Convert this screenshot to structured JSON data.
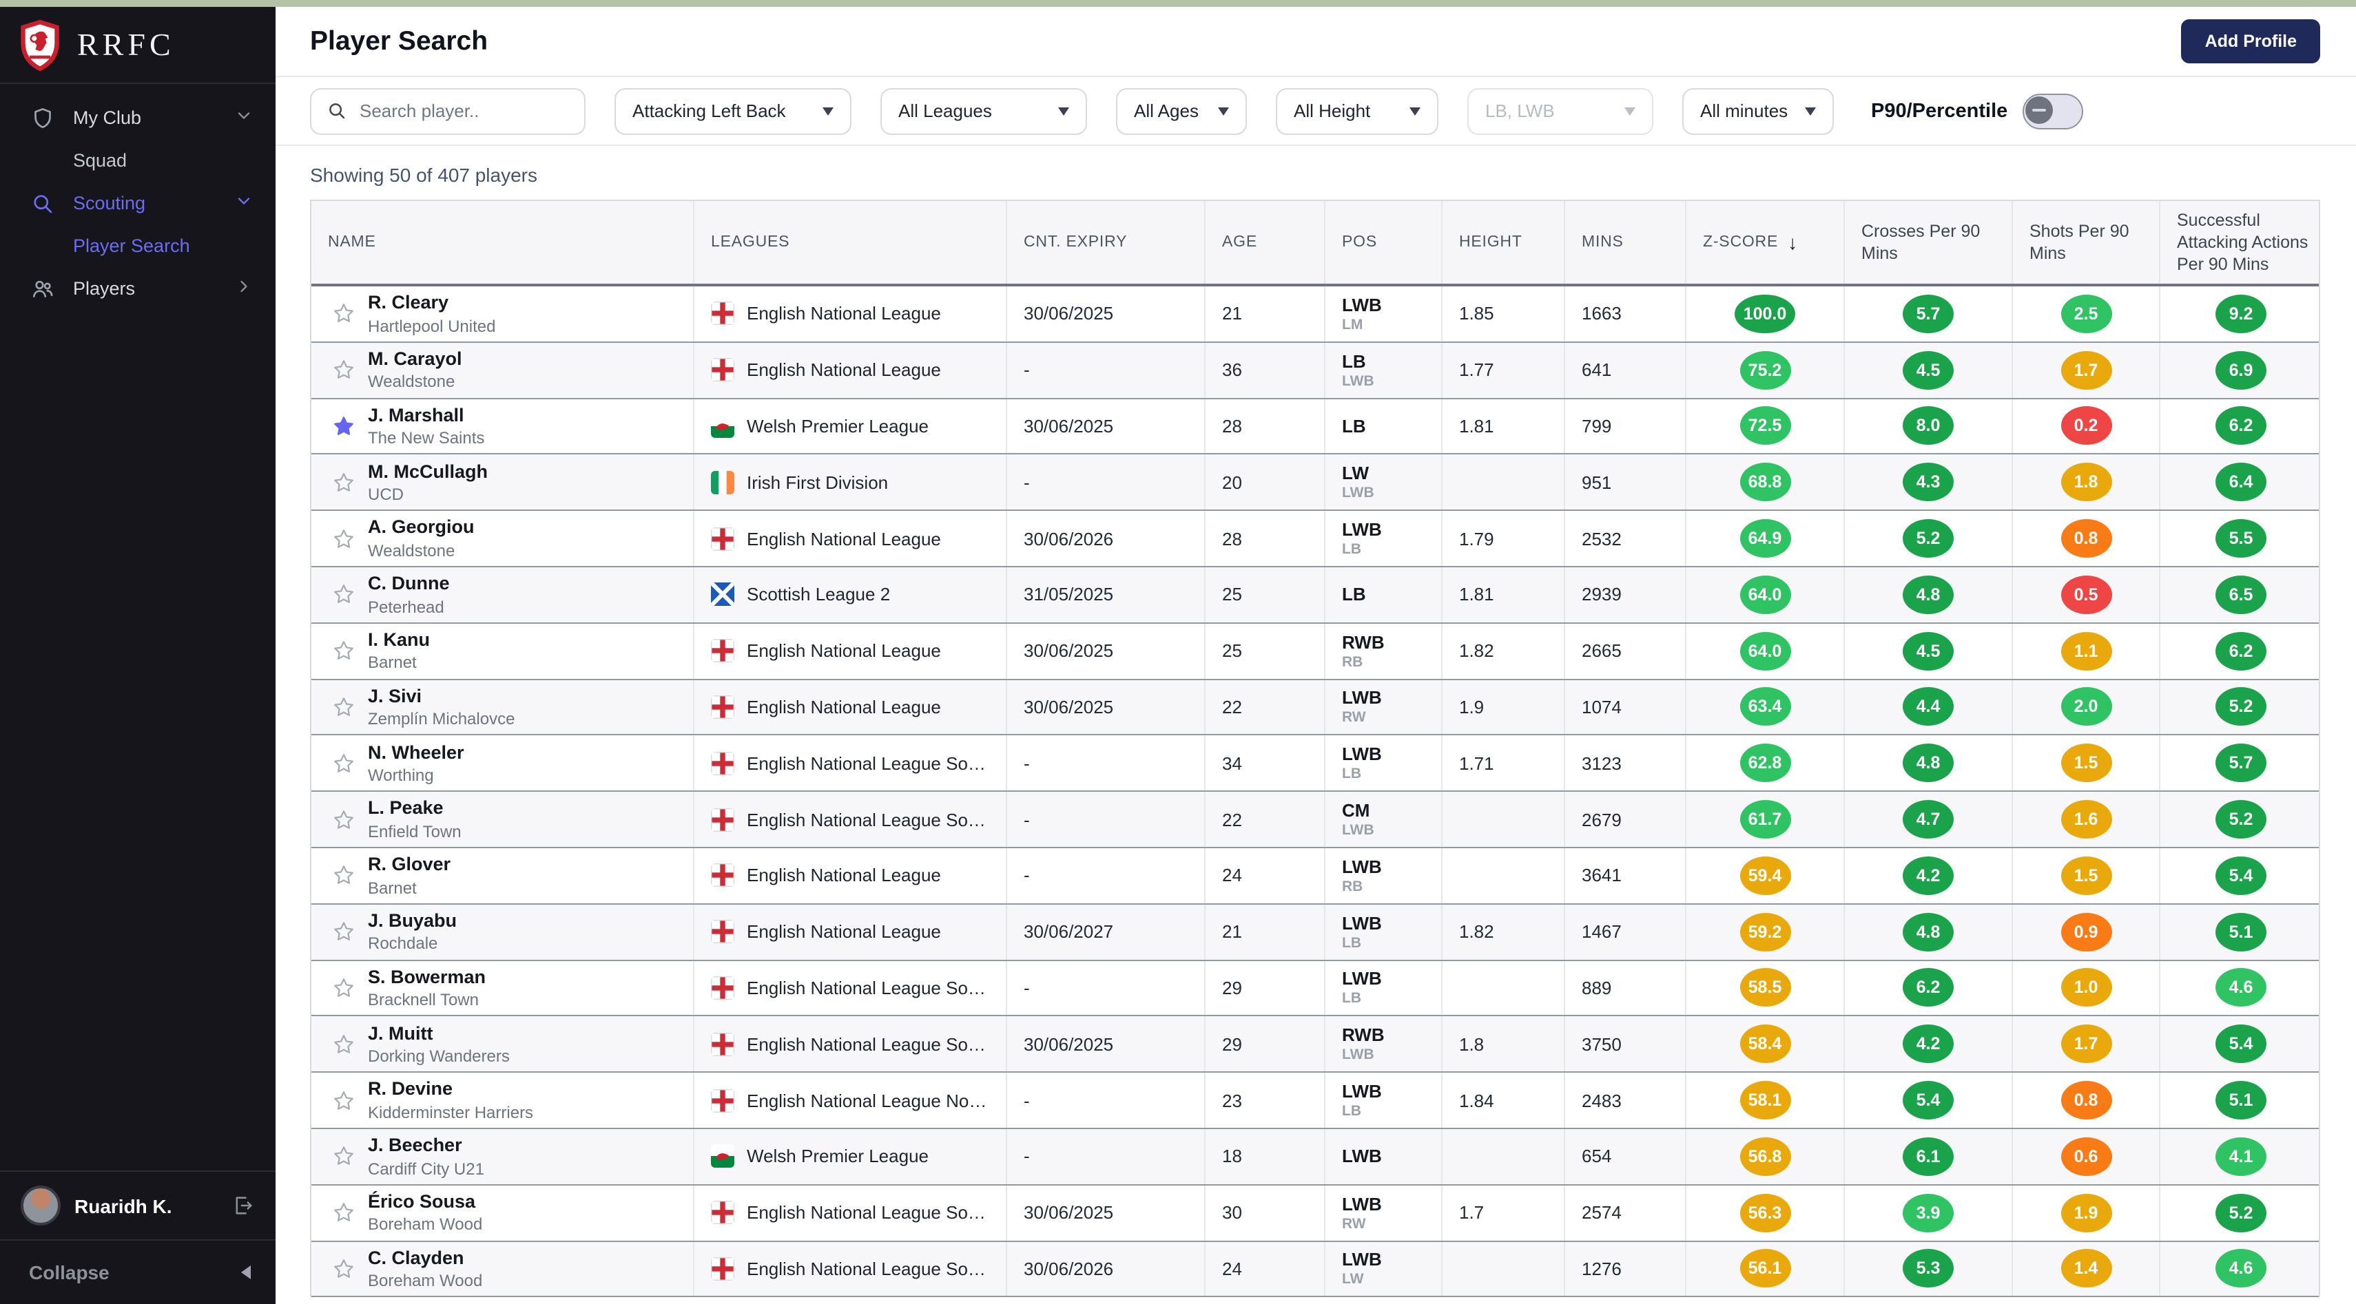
{
  "top_strip_color": "#b4c2a6",
  "brand": {
    "name": "RRFC"
  },
  "sidebar": {
    "items": [
      {
        "label": "My Club"
      },
      {
        "label": "Squad"
      },
      {
        "label": "Scouting"
      },
      {
        "label": "Player Search"
      },
      {
        "label": "Players"
      }
    ],
    "user": {
      "name": "Ruaridh K."
    },
    "collapse_label": "Collapse"
  },
  "header": {
    "title": "Player Search",
    "add_profile_label": "Add Profile"
  },
  "filters": {
    "search_placeholder": "Search player..",
    "position": "Attacking Left Back",
    "leagues": "All Leagues",
    "ages": "All Ages",
    "height": "All Height",
    "positions_secondary": "LB, LWB",
    "minutes": "All minutes",
    "toggle_label": "P90/Percentile",
    "toggle_state": "off"
  },
  "results_summary": "Showing 50 of 407 players",
  "colors": {
    "badge_green": "#1aa34a",
    "badge_green_light": "#30c363",
    "badge_amber": "#e9a90c",
    "badge_orange": "#f97b16",
    "badge_red": "#ee4545",
    "accent_indigo": "#6466f1",
    "navy_button": "#202a5a"
  },
  "table": {
    "columns": [
      "NAME",
      "LEAGUES",
      "CNT. EXPIRY",
      "AGE",
      "POS",
      "HEIGHT",
      "MINS",
      "Z-SCORE",
      "Crosses Per 90 Mins",
      "Shots Per 90 Mins",
      "Successful Attacking Actions Per 90 Mins"
    ],
    "sort_column": "Z-SCORE",
    "sort_direction": "desc",
    "rows": [
      {
        "starred": false,
        "name": "R. Cleary",
        "club": "Hartlepool United",
        "flag": "england",
        "league": "English National League",
        "expiry": "30/06/2025",
        "age": "21",
        "pos": "LWB",
        "pos2": "LM",
        "height": "1.85",
        "mins": "1663",
        "zscore": {
          "v": "100.0",
          "c": "green"
        },
        "crosses": {
          "v": "5.7",
          "c": "green"
        },
        "shots": {
          "v": "2.5",
          "c": "green-light"
        },
        "saa": {
          "v": "9.2",
          "c": "green"
        }
      },
      {
        "starred": false,
        "name": "M. Carayol",
        "club": "Wealdstone",
        "flag": "england",
        "league": "English National League",
        "expiry": "-",
        "age": "36",
        "pos": "LB",
        "pos2": "LWB",
        "height": "1.77",
        "mins": "641",
        "zscore": {
          "v": "75.2",
          "c": "green-light"
        },
        "crosses": {
          "v": "4.5",
          "c": "green"
        },
        "shots": {
          "v": "1.7",
          "c": "amber"
        },
        "saa": {
          "v": "6.9",
          "c": "green"
        }
      },
      {
        "starred": true,
        "name": "J. Marshall",
        "club": "The New Saints",
        "flag": "wales",
        "league": "Welsh Premier League",
        "expiry": "30/06/2025",
        "age": "28",
        "pos": "LB",
        "pos2": "",
        "height": "1.81",
        "mins": "799",
        "zscore": {
          "v": "72.5",
          "c": "green-light"
        },
        "crosses": {
          "v": "8.0",
          "c": "green"
        },
        "shots": {
          "v": "0.2",
          "c": "red"
        },
        "saa": {
          "v": "6.2",
          "c": "green"
        }
      },
      {
        "starred": false,
        "name": "M. McCullagh",
        "club": "UCD",
        "flag": "ireland",
        "league": "Irish First Division",
        "expiry": "-",
        "age": "20",
        "pos": "LW",
        "pos2": "LWB",
        "height": "",
        "mins": "951",
        "zscore": {
          "v": "68.8",
          "c": "green-light"
        },
        "crosses": {
          "v": "4.3",
          "c": "green"
        },
        "shots": {
          "v": "1.8",
          "c": "amber"
        },
        "saa": {
          "v": "6.4",
          "c": "green"
        }
      },
      {
        "starred": false,
        "name": "A. Georgiou",
        "club": "Wealdstone",
        "flag": "england",
        "league": "English National League",
        "expiry": "30/06/2026",
        "age": "28",
        "pos": "LWB",
        "pos2": "LB",
        "height": "1.79",
        "mins": "2532",
        "zscore": {
          "v": "64.9",
          "c": "green-light"
        },
        "crosses": {
          "v": "5.2",
          "c": "green"
        },
        "shots": {
          "v": "0.8",
          "c": "orange"
        },
        "saa": {
          "v": "5.5",
          "c": "green"
        }
      },
      {
        "starred": false,
        "name": "C. Dunne",
        "club": "Peterhead",
        "flag": "scotland",
        "league": "Scottish League 2",
        "expiry": "31/05/2025",
        "age": "25",
        "pos": "LB",
        "pos2": "",
        "height": "1.81",
        "mins": "2939",
        "zscore": {
          "v": "64.0",
          "c": "green-light"
        },
        "crosses": {
          "v": "4.8",
          "c": "green"
        },
        "shots": {
          "v": "0.5",
          "c": "red"
        },
        "saa": {
          "v": "6.5",
          "c": "green"
        }
      },
      {
        "starred": false,
        "name": "I. Kanu",
        "club": "Barnet",
        "flag": "england",
        "league": "English National League",
        "expiry": "30/06/2025",
        "age": "25",
        "pos": "RWB",
        "pos2": "RB",
        "height": "1.82",
        "mins": "2665",
        "zscore": {
          "v": "64.0",
          "c": "green-light"
        },
        "crosses": {
          "v": "4.5",
          "c": "green"
        },
        "shots": {
          "v": "1.1",
          "c": "amber"
        },
        "saa": {
          "v": "6.2",
          "c": "green"
        }
      },
      {
        "starred": false,
        "name": "J. Sivi",
        "club": "Zemplín Michalovce",
        "flag": "england",
        "league": "English National League",
        "expiry": "30/06/2025",
        "age": "22",
        "pos": "LWB",
        "pos2": "RW",
        "height": "1.9",
        "mins": "1074",
        "zscore": {
          "v": "63.4",
          "c": "green-light"
        },
        "crosses": {
          "v": "4.4",
          "c": "green"
        },
        "shots": {
          "v": "2.0",
          "c": "green-light"
        },
        "saa": {
          "v": "5.2",
          "c": "green"
        }
      },
      {
        "starred": false,
        "name": "N. Wheeler",
        "club": "Worthing",
        "flag": "england",
        "league": "English National League So…",
        "expiry": "-",
        "age": "34",
        "pos": "LWB",
        "pos2": "LB",
        "height": "1.71",
        "mins": "3123",
        "zscore": {
          "v": "62.8",
          "c": "green-light"
        },
        "crosses": {
          "v": "4.8",
          "c": "green"
        },
        "shots": {
          "v": "1.5",
          "c": "amber"
        },
        "saa": {
          "v": "5.7",
          "c": "green"
        }
      },
      {
        "starred": false,
        "name": "L. Peake",
        "club": "Enfield Town",
        "flag": "england",
        "league": "English National League So…",
        "expiry": "-",
        "age": "22",
        "pos": "CM",
        "pos2": "LWB",
        "height": "",
        "mins": "2679",
        "zscore": {
          "v": "61.7",
          "c": "green-light"
        },
        "crosses": {
          "v": "4.7",
          "c": "green"
        },
        "shots": {
          "v": "1.6",
          "c": "amber"
        },
        "saa": {
          "v": "5.2",
          "c": "green"
        }
      },
      {
        "starred": false,
        "name": "R. Glover",
        "club": "Barnet",
        "flag": "england",
        "league": "English National League",
        "expiry": "-",
        "age": "24",
        "pos": "LWB",
        "pos2": "RB",
        "height": "",
        "mins": "3641",
        "zscore": {
          "v": "59.4",
          "c": "amber"
        },
        "crosses": {
          "v": "4.2",
          "c": "green"
        },
        "shots": {
          "v": "1.5",
          "c": "amber"
        },
        "saa": {
          "v": "5.4",
          "c": "green"
        }
      },
      {
        "starred": false,
        "name": "J. Buyabu",
        "club": "Rochdale",
        "flag": "england",
        "league": "English National League",
        "expiry": "30/06/2027",
        "age": "21",
        "pos": "LWB",
        "pos2": "LB",
        "height": "1.82",
        "mins": "1467",
        "zscore": {
          "v": "59.2",
          "c": "amber"
        },
        "crosses": {
          "v": "4.8",
          "c": "green"
        },
        "shots": {
          "v": "0.9",
          "c": "orange"
        },
        "saa": {
          "v": "5.1",
          "c": "green"
        }
      },
      {
        "starred": false,
        "name": "S. Bowerman",
        "club": "Bracknell Town",
        "flag": "england",
        "league": "English National League So…",
        "expiry": "-",
        "age": "29",
        "pos": "LWB",
        "pos2": "LB",
        "height": "",
        "mins": "889",
        "zscore": {
          "v": "58.5",
          "c": "amber"
        },
        "crosses": {
          "v": "6.2",
          "c": "green"
        },
        "shots": {
          "v": "1.0",
          "c": "amber"
        },
        "saa": {
          "v": "4.6",
          "c": "green-light"
        }
      },
      {
        "starred": false,
        "name": "J. Muitt",
        "club": "Dorking Wanderers",
        "flag": "england",
        "league": "English National League So…",
        "expiry": "30/06/2025",
        "age": "29",
        "pos": "RWB",
        "pos2": "LWB",
        "height": "1.8",
        "mins": "3750",
        "zscore": {
          "v": "58.4",
          "c": "amber"
        },
        "crosses": {
          "v": "4.2",
          "c": "green"
        },
        "shots": {
          "v": "1.7",
          "c": "amber"
        },
        "saa": {
          "v": "5.4",
          "c": "green"
        }
      },
      {
        "starred": false,
        "name": "R. Devine",
        "club": "Kidderminster Harriers",
        "flag": "england",
        "league": "English National League No…",
        "expiry": "-",
        "age": "23",
        "pos": "LWB",
        "pos2": "LB",
        "height": "1.84",
        "mins": "2483",
        "zscore": {
          "v": "58.1",
          "c": "amber"
        },
        "crosses": {
          "v": "5.4",
          "c": "green"
        },
        "shots": {
          "v": "0.8",
          "c": "orange"
        },
        "saa": {
          "v": "5.1",
          "c": "green"
        }
      },
      {
        "starred": false,
        "name": "J. Beecher",
        "club": "Cardiff City U21",
        "flag": "wales",
        "league": "Welsh Premier League",
        "expiry": "-",
        "age": "18",
        "pos": "LWB",
        "pos2": "",
        "height": "",
        "mins": "654",
        "zscore": {
          "v": "56.8",
          "c": "amber"
        },
        "crosses": {
          "v": "6.1",
          "c": "green"
        },
        "shots": {
          "v": "0.6",
          "c": "orange"
        },
        "saa": {
          "v": "4.1",
          "c": "green-light"
        }
      },
      {
        "starred": false,
        "name": "Érico Sousa",
        "club": "Boreham Wood",
        "flag": "england",
        "league": "English National League So…",
        "expiry": "30/06/2025",
        "age": "30",
        "pos": "LWB",
        "pos2": "RW",
        "height": "1.7",
        "mins": "2574",
        "zscore": {
          "v": "56.3",
          "c": "amber"
        },
        "crosses": {
          "v": "3.9",
          "c": "green-light"
        },
        "shots": {
          "v": "1.9",
          "c": "amber"
        },
        "saa": {
          "v": "5.2",
          "c": "green"
        }
      },
      {
        "starred": false,
        "name": "C. Clayden",
        "club": "Boreham Wood",
        "flag": "england",
        "league": "English National League So…",
        "expiry": "30/06/2026",
        "age": "24",
        "pos": "LWB",
        "pos2": "LW",
        "height": "",
        "mins": "1276",
        "zscore": {
          "v": "56.1",
          "c": "amber"
        },
        "crosses": {
          "v": "5.3",
          "c": "green"
        },
        "shots": {
          "v": "1.4",
          "c": "amber"
        },
        "saa": {
          "v": "4.6",
          "c": "green-light"
        }
      }
    ]
  }
}
